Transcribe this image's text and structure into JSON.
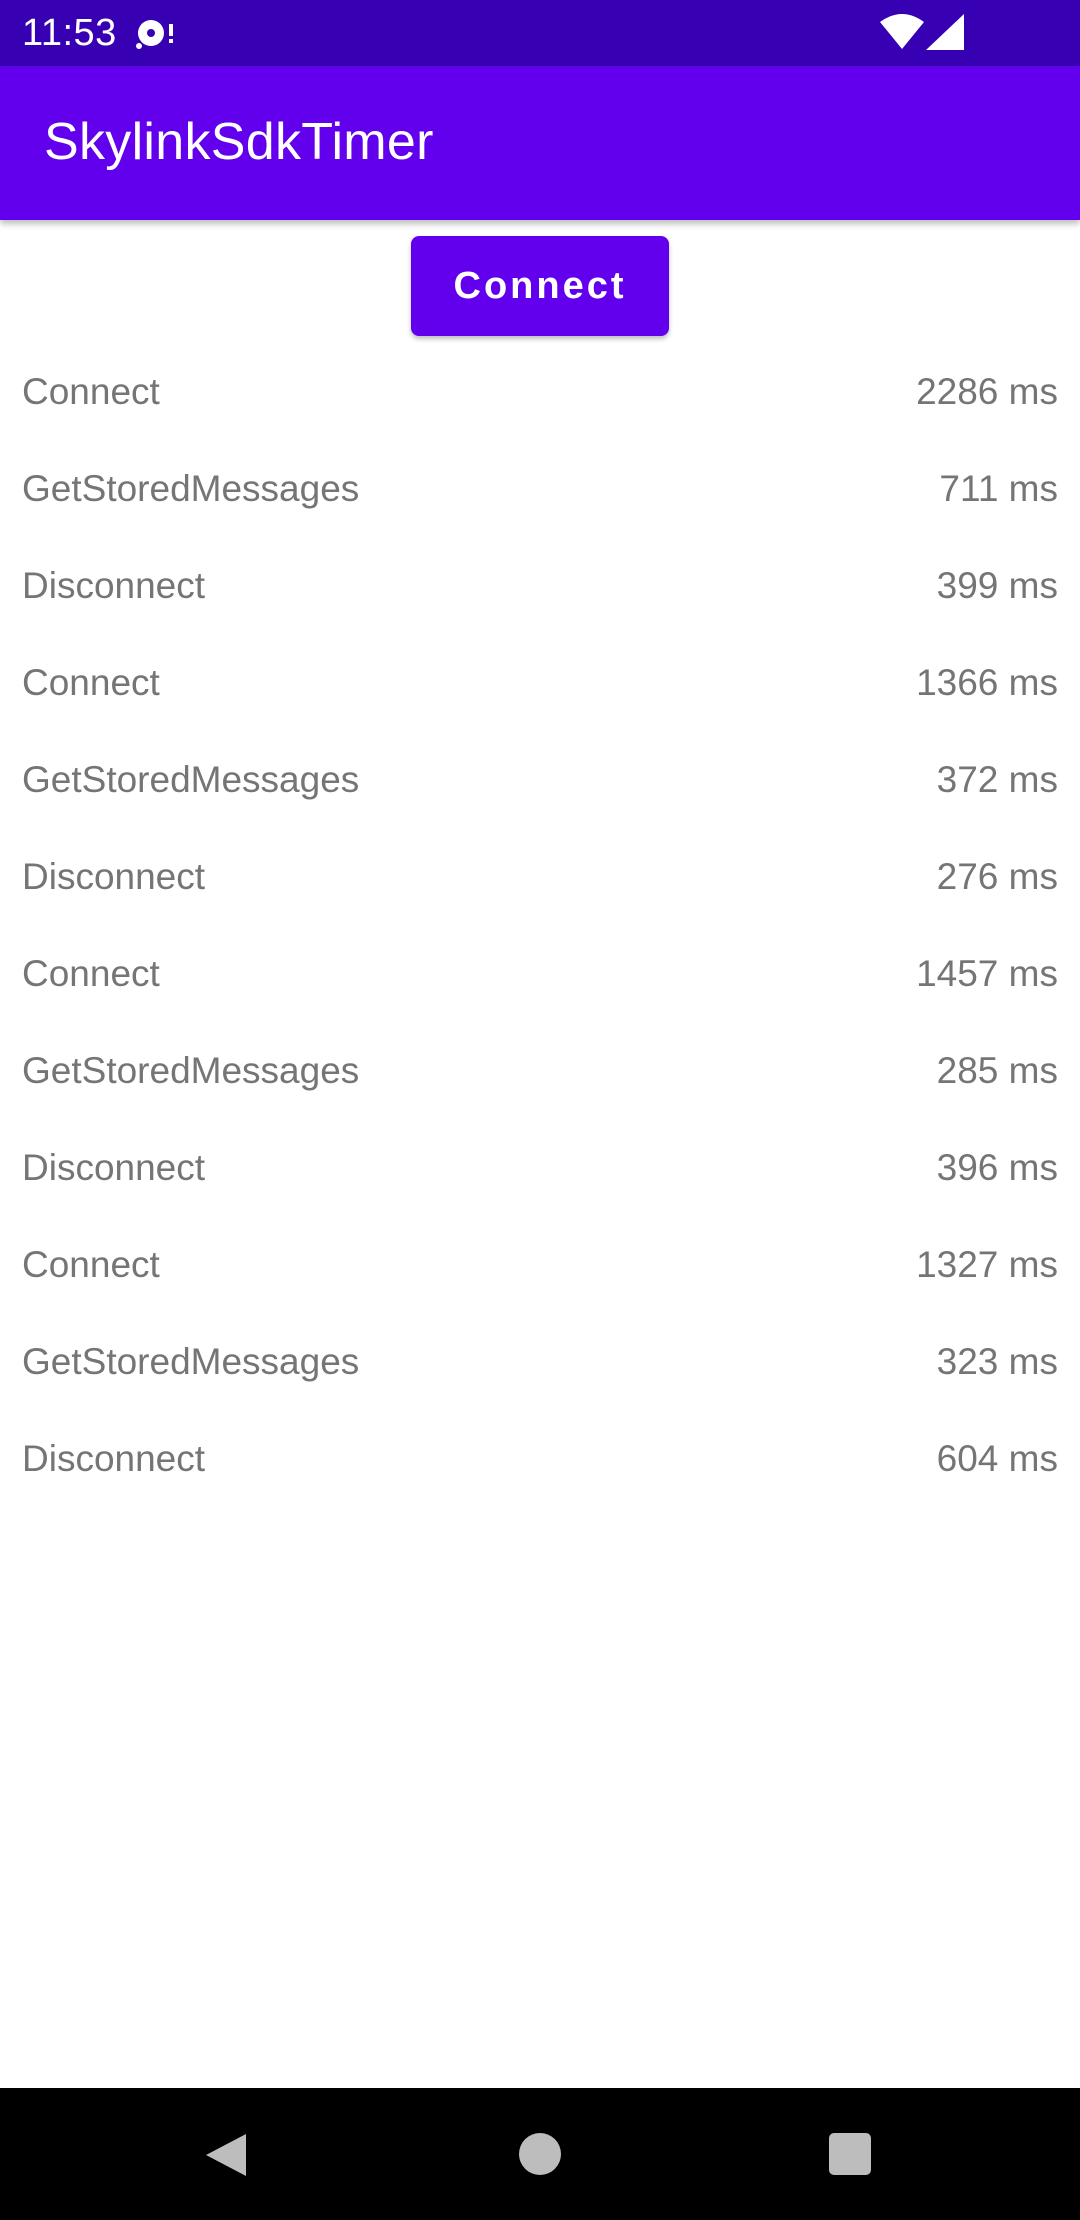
{
  "status_bar": {
    "time": "11:53",
    "icons": [
      "media-icon",
      "wifi-icon",
      "signal-icon"
    ]
  },
  "app_bar": {
    "title": "SkylinkSdkTimer"
  },
  "connect_button": {
    "label": "Connect"
  },
  "results": [
    {
      "name": "Connect",
      "time": "2286 ms"
    },
    {
      "name": "GetStoredMessages",
      "time": "711 ms"
    },
    {
      "name": "Disconnect",
      "time": "399 ms"
    },
    {
      "name": "Connect",
      "time": "1366 ms"
    },
    {
      "name": "GetStoredMessages",
      "time": "372 ms"
    },
    {
      "name": "Disconnect",
      "time": "276 ms"
    },
    {
      "name": "Connect",
      "time": "1457 ms"
    },
    {
      "name": "GetStoredMessages",
      "time": "285 ms"
    },
    {
      "name": "Disconnect",
      "time": "396 ms"
    },
    {
      "name": "Connect",
      "time": "1327 ms"
    },
    {
      "name": "GetStoredMessages",
      "time": "323 ms"
    },
    {
      "name": "Disconnect",
      "time": "604 ms"
    }
  ],
  "nav_bar": {
    "icons": [
      "back-icon",
      "home-icon",
      "recents-icon"
    ]
  },
  "colors": {
    "status_bar": "#3700b3",
    "primary": "#6200ee",
    "text_secondary": "#757575",
    "nav_bar": "#000000"
  }
}
